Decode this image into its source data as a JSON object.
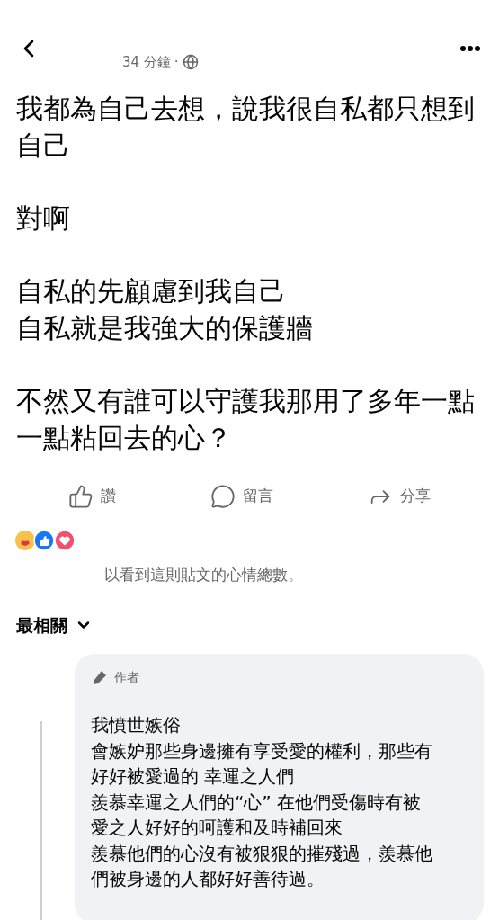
{
  "header": {
    "time": "34 分鐘",
    "separator": "·"
  },
  "post": {
    "paragraphs": [
      [
        "我都為自己去想，說我很自私都只想到自己"
      ],
      [
        "對啊"
      ],
      [
        "自私的先顧慮到我自己",
        "自私就是我強大的保護牆"
      ],
      [
        "不然又有誰可以守護我那用了多年一點一點粘回去的心？"
      ]
    ]
  },
  "actions": [
    {
      "kind": "like",
      "label": "讚"
    },
    {
      "kind": "comment",
      "label": "留言"
    },
    {
      "kind": "share",
      "label": "分享"
    }
  ],
  "reactions": {
    "note": "以看到這則貼文的心情總數。"
  },
  "sort": {
    "label": "最相關"
  },
  "comment": {
    "badge": "作者",
    "lines": [
      "我憤世嫉俗",
      "會嫉妒那些身邊擁有享受愛的權利，那些有",
      "好好被愛過的 幸運之人們",
      "羨慕幸運之人們的“心” 在他們受傷時有被",
      "愛之人好好的呵護和及時補回來",
      "羨慕他們的心沒有被狠狠的摧殘過，羨慕他",
      "們被身邊的人都好好善待過。"
    ]
  }
}
